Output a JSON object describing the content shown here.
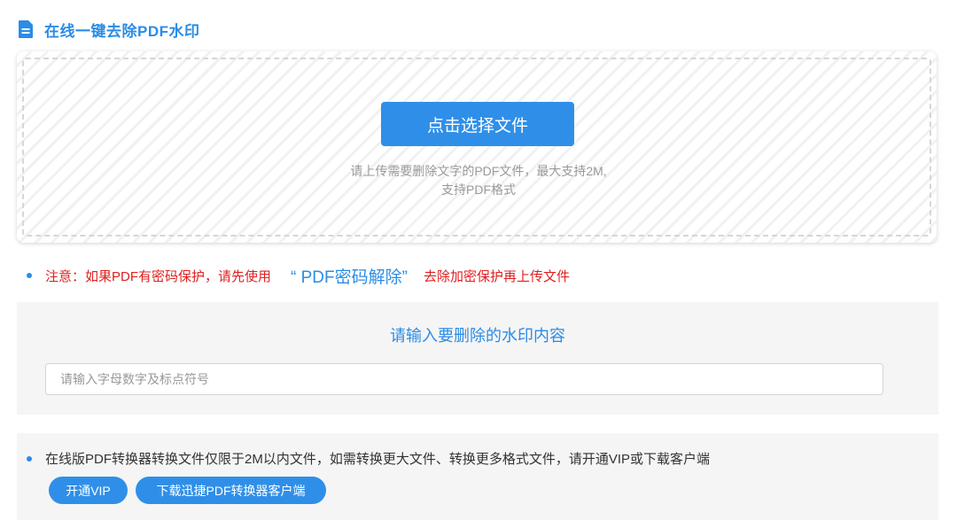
{
  "header": {
    "title": "在线一键去除PDF水印",
    "icon": "document-icon"
  },
  "upload": {
    "button_label": "点击选择文件",
    "hint_line1": "请上传需要删除文字的PDF文件，最大支持2M,",
    "hint_line2": "支持PDF格式"
  },
  "notice": {
    "prefix": "注意：如果PDF有密码保护，请先使用",
    "link_label": "“ PDF密码解除”",
    "suffix": "去除加密保护再上传文件"
  },
  "watermark": {
    "heading": "请输入要删除的水印内容",
    "input_value": "",
    "input_placeholder": "请输入字母数字及标点符号"
  },
  "vip": {
    "text": "在线版PDF转换器转换文件仅限于2M以内文件，如需转换更大文件、转换更多格式文件，请开通VIP或下载客户端",
    "vip_button": "开通VIP",
    "download_button": "下载迅捷PDF转换器客户端"
  },
  "colors": {
    "accent": "#2b8ce6",
    "button": "#2f8fe8",
    "warning": "#e02020",
    "panel_bg": "#f5f5f5"
  }
}
